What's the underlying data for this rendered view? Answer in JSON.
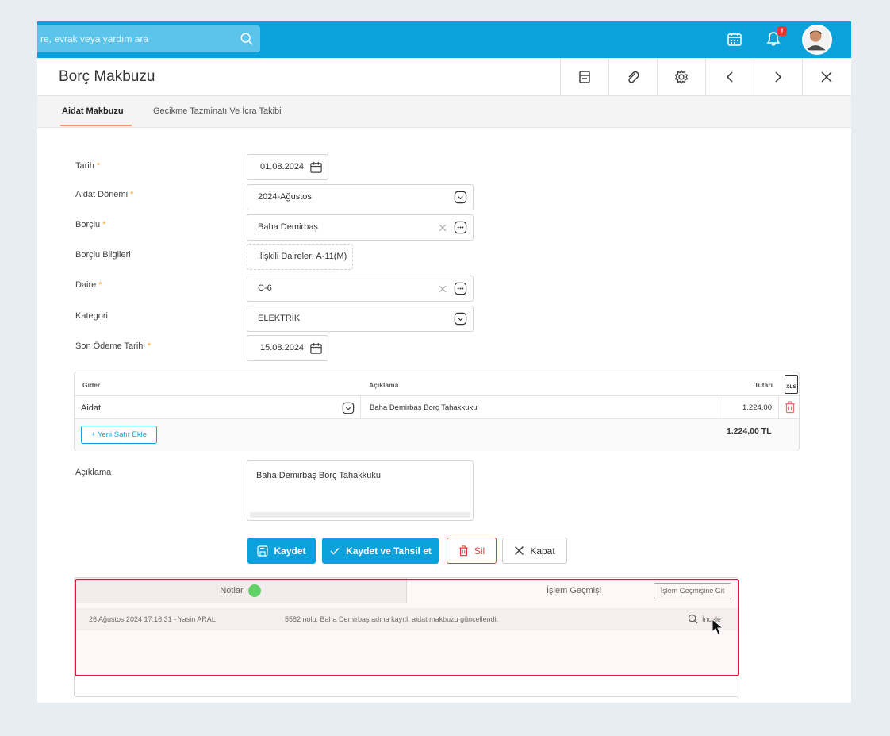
{
  "topbar": {
    "search_placeholder": "re, evrak veya yardım ara",
    "icons": [
      "search-icon",
      "calendar-icon",
      "bell-icon",
      "avatar"
    ],
    "notification_badge": "!"
  },
  "header": {
    "title": "Borç Makbuzu",
    "actions": [
      "print-icon",
      "attachment-icon",
      "gear-icon",
      "chevron-left-icon",
      "chevron-right-icon",
      "close-icon"
    ]
  },
  "tabs": [
    {
      "label": "Aidat Makbuzu",
      "active": true
    },
    {
      "label": "Gecikme Tazminatı Ve İcra Takibi",
      "active": false
    }
  ],
  "form": {
    "tarih": {
      "label": "Tarih",
      "value": "01.08.2024"
    },
    "aidat_donemi": {
      "label": "Aidat Dönemi",
      "value": "2024-Ağustos"
    },
    "borclu": {
      "label": "Borçlu",
      "value": "Baha Demirbaş"
    },
    "borclu_bilgileri": {
      "label": "Borçlu Bilgileri",
      "value": "İlişkili Daireler: A-11(M)"
    },
    "daire": {
      "label": "Daire",
      "value": "C-6"
    },
    "kategori": {
      "label": "Kategori",
      "value": "ELEKTRİK"
    },
    "son_odeme_tarihi": {
      "label": "Son Ödeme Tarihi",
      "value": "15.08.2024"
    },
    "required_mark": "*"
  },
  "grid": {
    "headers": {
      "gider": "Gider",
      "aciklama": "Açıklama",
      "tutar": "Tutarı"
    },
    "export_label": "XLS",
    "rows": [
      {
        "gider": "Aidat",
        "aciklama": "Baha Demirbaş Borç Tahakkuku",
        "tutar": "1.224,00"
      }
    ],
    "add_row_label": "+ Yeni Satır Ekle",
    "total": "1.224,00 TL"
  },
  "aciklama": {
    "label": "Açıklama",
    "value": "Baha Demirbaş Borç Tahakkuku"
  },
  "buttons": {
    "kaydet": "Kaydet",
    "kaydet_tahsil": "Kaydet ve Tahsil et",
    "sil": "Sil",
    "kapat": "Kapat"
  },
  "notes": {
    "tab_notlar": "Notlar",
    "tab_islem": "İşlem Geçmişi",
    "goto_label": "İşlem Geçmişine Git",
    "log": [
      {
        "who": "26 Ağustos 2024 17:16:31 - Yasin ARAL",
        "text": "5582 nolu, Baha Demirbaş adına kayıtlı aidat makbuzu güncellendi.",
        "action": "İncele"
      }
    ]
  },
  "colors": {
    "brand": "#0ba2dc",
    "danger": "#e53935",
    "highlight": "#d81b3c",
    "status_green": "#2ecc40"
  }
}
